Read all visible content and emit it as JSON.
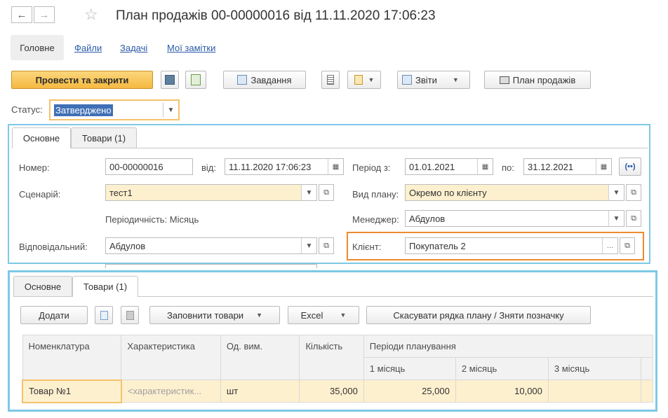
{
  "window": {
    "title": "План продажів 00-00000016 від 11.11.2020 17:06:23"
  },
  "nav": {
    "back": "←",
    "forward": "→",
    "favorite": "☆"
  },
  "sections": {
    "main": "Головне",
    "files": "Файли",
    "tasks": "Задачі",
    "notes": "Мої замітки"
  },
  "toolbar": {
    "post_close": "Провести та закрити",
    "task": "Завдання",
    "reports": "Звіти",
    "sales_plan": "План продажів"
  },
  "status": {
    "label": "Статус:",
    "value": "Затверджено"
  },
  "header_tabs": [
    "Основне",
    "Товари (1)"
  ],
  "form": {
    "number_label": "Номер:",
    "number": "00-00000016",
    "from_label": "від:",
    "date": "11.11.2020 17:06:23",
    "period_from_label": "Період з:",
    "period_from": "01.01.2021",
    "period_to_label": "по:",
    "period_to": "31.12.2021",
    "scenario_label": "Сценарій:",
    "scenario": "тест1",
    "plan_type_label": "Вид плану:",
    "plan_type": "Окремо по клієнту",
    "periodicity": "Періодичність: Місяць",
    "manager_label": "Менеджер:",
    "manager": "Абдулов",
    "responsible_label": "Відповідальний:",
    "responsible": "Абдулов",
    "client_label": "Клієнт:",
    "client": "Покупатель 2"
  },
  "lower_tabs": [
    "Основне",
    "Товари (1)"
  ],
  "goods_toolbar": {
    "add": "Додати",
    "fill": "Заповнити товари",
    "excel": "Excel",
    "cancel_rows": "Скасувати рядка плану / Зняти позначку"
  },
  "table": {
    "columns": [
      "Номенклатура",
      "Характеристика",
      "Од. вим.",
      "Кількість",
      "Періоди планування"
    ],
    "periods": [
      "1 місяць",
      "2 місяць",
      "3 місяць"
    ],
    "rows": [
      {
        "item": "Товар №1",
        "characteristic": "<характеристик...",
        "unit": "шт",
        "qty": "35,000",
        "m1": "25,000",
        "m2": "10,000",
        "m3": ""
      }
    ]
  }
}
